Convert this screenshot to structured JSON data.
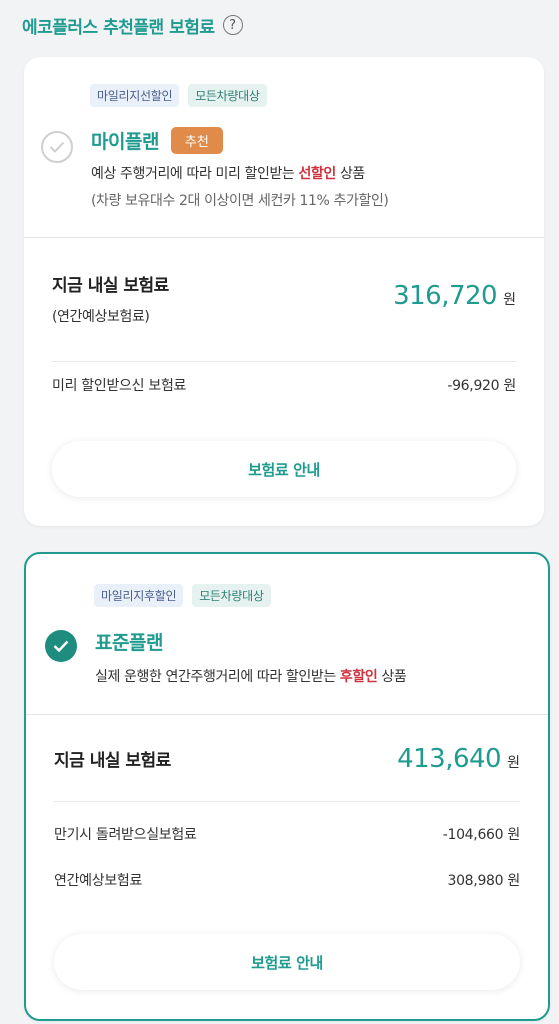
{
  "header": {
    "title": "에코플러스 추천플랜 보험료",
    "help_icon": "?"
  },
  "plan1": {
    "tags": [
      "마일리지선할인",
      "모든차량대상"
    ],
    "name": "마이플랜",
    "badge": "추천",
    "desc_prefix": "예상 주행거리에 따라 미리 할인받는 ",
    "desc_highlight": "선할인",
    "desc_suffix": " 상품",
    "subdesc": "(차량 보유대수 2대 이상이면 세컨카 11% 추가할인)",
    "main_label": "지금 내실 보험료",
    "main_sub": "(연간예상보험료)",
    "amount": "316,720",
    "unit": "원",
    "rows": [
      {
        "label": "미리 할인받으신 보험료",
        "value": "-96,920 원"
      }
    ],
    "button": "보험료 안내",
    "selected": false
  },
  "plan2": {
    "tags": [
      "마일리지후할인",
      "모든차량대상"
    ],
    "name": "표준플랜",
    "desc_prefix": "실제 운행한 연간주행거리에 따라 할인받는 ",
    "desc_highlight": "후할인",
    "desc_suffix": " 상품",
    "main_label": "지금 내실 보험료",
    "amount": "413,640",
    "unit": "원",
    "rows": [
      {
        "label": "만기시 돌려받으실보험료",
        "value": "-104,660 원"
      },
      {
        "label": "연간예상보험료",
        "value": "308,980 원"
      }
    ],
    "button": "보험료 안내",
    "selected": true
  },
  "colors": {
    "accent": "#1f9b8f",
    "highlight": "#d1323d",
    "badge": "#e08b4a"
  }
}
